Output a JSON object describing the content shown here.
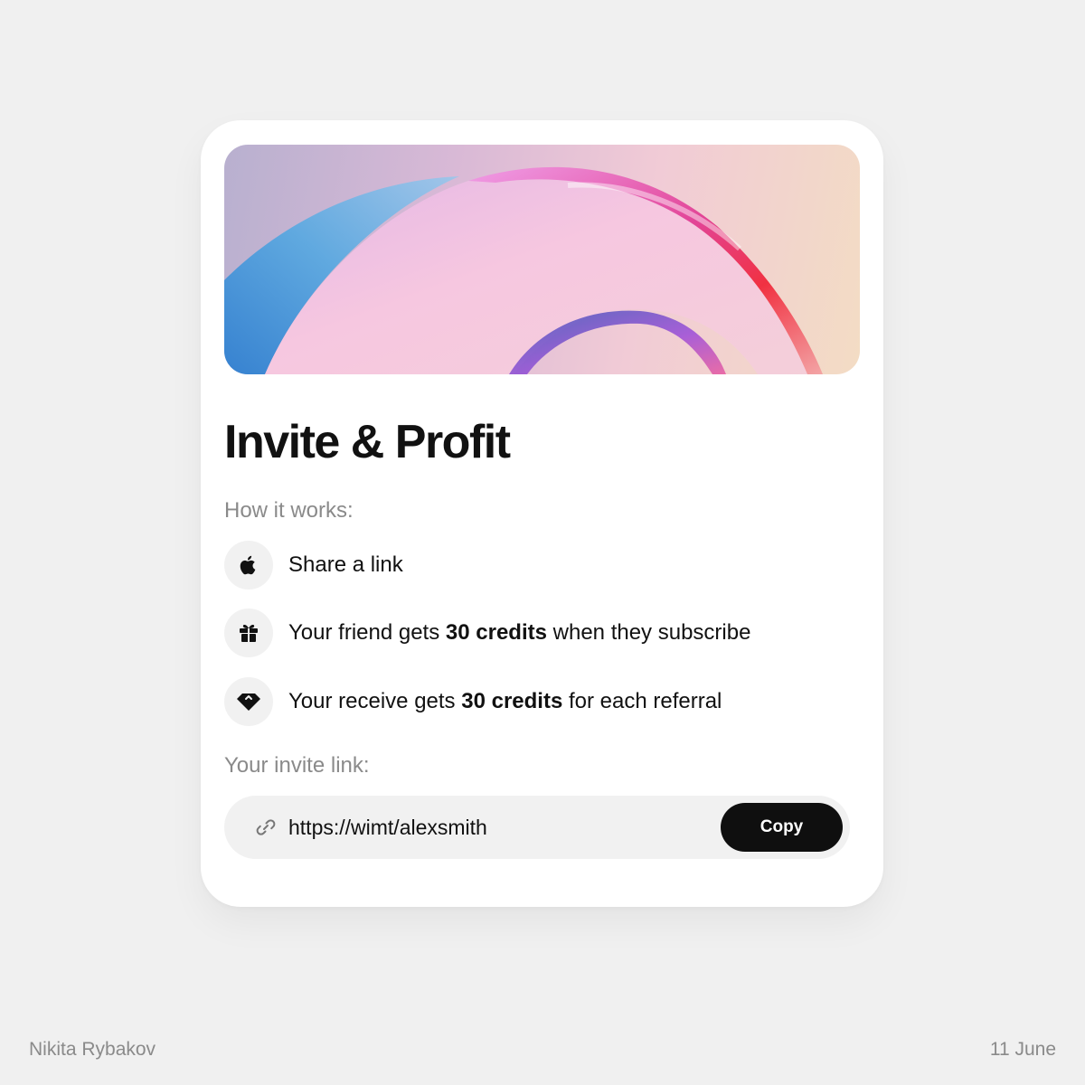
{
  "card": {
    "title": "Invite & Profit",
    "how_label": "How it works:",
    "steps": [
      {
        "icon": "apple-icon",
        "text_parts": [
          "Share a link"
        ]
      },
      {
        "icon": "gift-icon",
        "text_before": "Your friend gets ",
        "text_bold": "30 credits",
        "text_after": " when they subscribe"
      },
      {
        "icon": "diamond-icon",
        "text_before": "Your receive gets ",
        "text_bold": "30 credits",
        "text_after": " for each referral"
      }
    ],
    "invite_label": "Your invite link:",
    "invite_url": "https://wimt/alexsmith",
    "copy_label": "Copy"
  },
  "footer": {
    "author": "Nikita Rybakov",
    "date": "11 June"
  },
  "colors": {
    "background": "#f0f0f0",
    "card": "#ffffff",
    "button": "#0f0f0f",
    "muted_text": "#8a8a8a"
  }
}
